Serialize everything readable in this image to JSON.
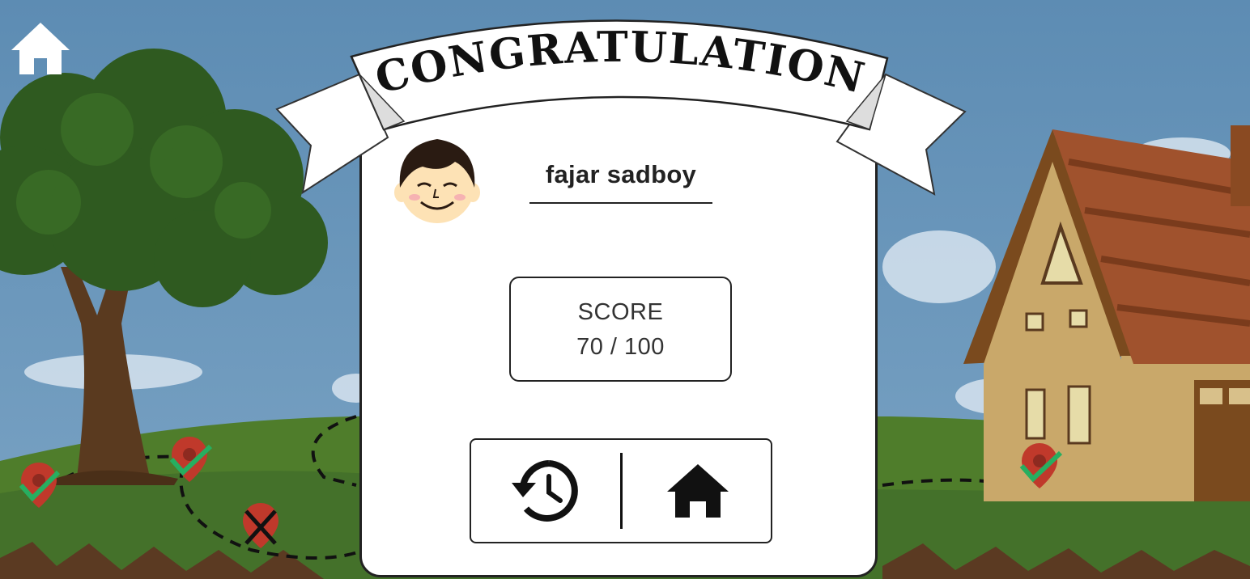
{
  "banner": {
    "title": "CONGRATULATION"
  },
  "player": {
    "name": "fajar sadboy"
  },
  "score": {
    "label": "SCORE",
    "value": "70 / 100",
    "points": 70,
    "max": 100
  },
  "actions": [
    {
      "id": "retry",
      "icon": "history-icon"
    },
    {
      "id": "home",
      "icon": "home-icon"
    }
  ],
  "top_left": {
    "icon": "home-icon"
  },
  "map_markers": [
    {
      "status": "completed",
      "icon": "check-icon"
    },
    {
      "status": "completed",
      "icon": "check-icon"
    },
    {
      "status": "failed",
      "icon": "cross-icon"
    },
    {
      "status": "completed",
      "icon": "check-icon"
    }
  ],
  "colors": {
    "sky": "#6b95b8",
    "grass": "#4a7a2a",
    "marker": "#c0392b",
    "check": "#27ae60",
    "card": "#ffffff"
  }
}
